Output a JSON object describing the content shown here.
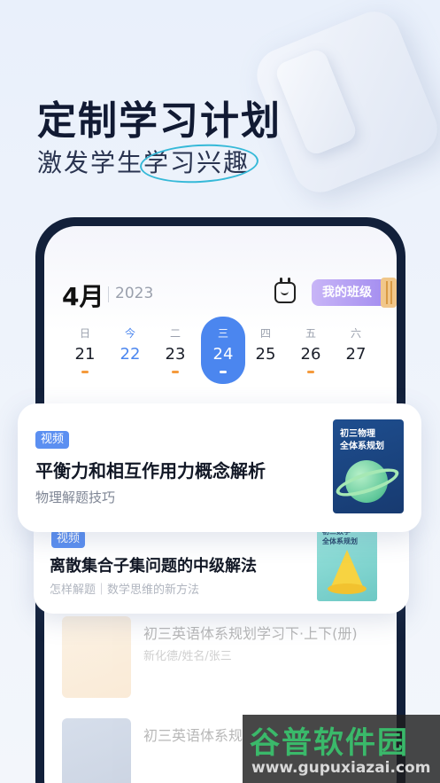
{
  "header": {
    "headline": "定制学习计划",
    "sub_prefix": "激发学生",
    "sub_highlight": "学习兴趣"
  },
  "calendar": {
    "month": "4月",
    "year": "2023",
    "class_button": "我的班级",
    "days": [
      {
        "weekday": "日",
        "date": "21",
        "dot": true
      },
      {
        "weekday": "今",
        "date": "22",
        "dot": false,
        "today": true
      },
      {
        "weekday": "二",
        "date": "23",
        "dot": true
      },
      {
        "weekday": "三",
        "date": "24",
        "dot": true,
        "active": true
      },
      {
        "weekday": "四",
        "date": "25",
        "dot": false
      },
      {
        "weekday": "五",
        "date": "26",
        "dot": true
      },
      {
        "weekday": "六",
        "date": "27",
        "dot": false
      }
    ]
  },
  "cards": [
    {
      "tag": "视频",
      "title": "平衡力和相互作用力概念解析",
      "subtitle": "物理解题技巧",
      "cover_text": "初三物理\n全体系规划"
    },
    {
      "tag": "视频",
      "title": "离散集合子集问题的中级解法",
      "subtitle": "怎样解题｜数学思维的新方法",
      "cover_text": "初三数学\n全体系规划"
    }
  ],
  "faded_items": [
    {
      "title": "初三英语体系规划学习下·上下(册)",
      "subtitle": "新化德/姓名/张三"
    },
    {
      "title": "初三英语体系规",
      "subtitle": ""
    }
  ],
  "watermark": {
    "title": "谷普软件园",
    "url": "www.gupuxiazai.com"
  }
}
